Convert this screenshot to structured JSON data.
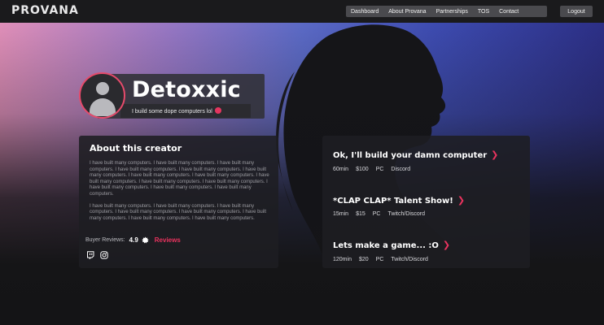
{
  "brand": {
    "logo_text": "PROVANA"
  },
  "nav": {
    "items": [
      {
        "label": "Dashboard"
      },
      {
        "label": "About Provana"
      },
      {
        "label": "Partnerships"
      },
      {
        "label": "TOS"
      },
      {
        "label": "Contact"
      }
    ],
    "logout_label": "Logout"
  },
  "profile": {
    "name": "Detoxxic",
    "tagline": "I build some dope computers lol"
  },
  "about": {
    "title": "About this creator",
    "paragraphs": [
      "I have built many computers. I have built many computers. I have built many computers. I have built many computers. I have built many computers. I have built many computers. I have built many computers. I have built many computers. I have built many computers. I have built many computers. I have built many computers. I have built many computers. I have built many computers. I have built many computers.",
      "I have built many computers. I have built many computers. I have built many computers. I have built many computers. I have built many computers. I have built many computers. I have built many computers. I have built many computers."
    ],
    "reviews_label": "Buyer Reviews:",
    "rating": "4.9",
    "reviews_link": "Reviews",
    "icons": [
      "twitch-icon",
      "instagram-icon"
    ]
  },
  "offerings": [
    {
      "title": "Ok, I'll build your damn computer",
      "duration": "60min",
      "price": "$100",
      "platform": "PC",
      "contact": "Discord"
    },
    {
      "title": "*CLAP CLAP* Talent Show!",
      "duration": "15min",
      "price": "$15",
      "platform": "PC",
      "contact": "Twitch/Discord"
    },
    {
      "title": "Lets make a game... :O",
      "duration": "120min",
      "price": "$20",
      "platform": "PC",
      "contact": "Twitch/Discord"
    }
  ],
  "colors": {
    "accent": "#e9335e",
    "background": "#161618",
    "card": "#1e1e22",
    "hero_gradient": [
      "#e08fb9",
      "#9777c4",
      "#5b6ac6",
      "#2c2f86"
    ]
  }
}
